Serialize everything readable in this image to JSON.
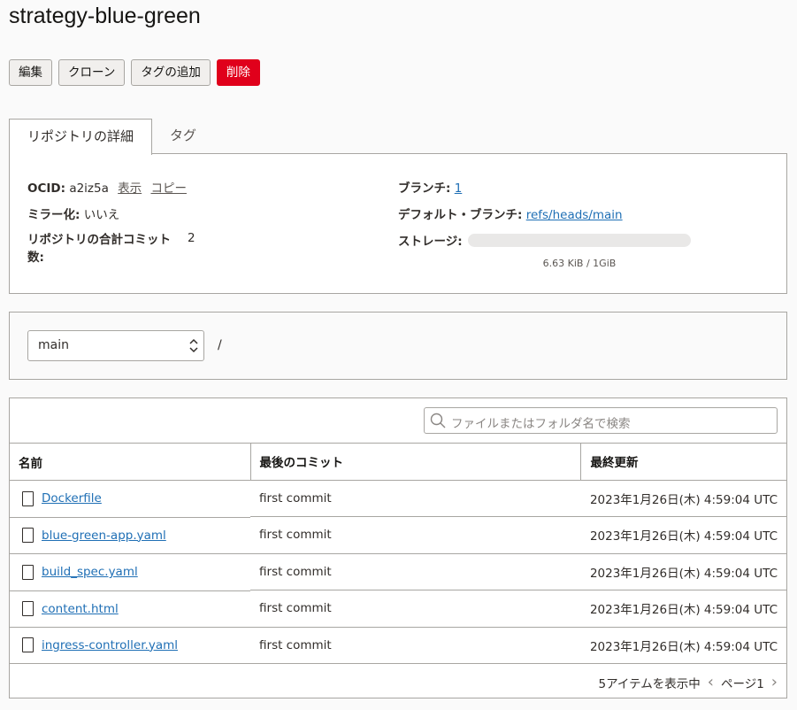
{
  "title": "strategy-blue-green",
  "actions": {
    "edit": "編集",
    "clone": "クローン",
    "add_tags": "タグの追加",
    "delete": "削除"
  },
  "tabs": {
    "details": "リポジトリの詳細",
    "tags": "タグ"
  },
  "details": {
    "ocid_label": "OCID:",
    "ocid_value": "a2iz5a",
    "show": "表示",
    "copy": "コピー",
    "mirror_label": "ミラー化:",
    "mirror_value": "いいえ",
    "commits_label": "リポジトリの合計コミット数:",
    "commits_value": "2",
    "branch_label": "ブランチ:",
    "branch_value": "1",
    "default_branch_label": "デフォルト・ブランチ:",
    "default_branch_value": "refs/heads/main",
    "storage_label": "ストレージ:",
    "storage_text": "6.63 KiB / 1GiB",
    "storage_fraction": 6.2e-06
  },
  "branch_select": {
    "value": "main",
    "path": "/"
  },
  "search": {
    "placeholder": "ファイルまたはフォルダ名で検索"
  },
  "table": {
    "headers": [
      "名前",
      "最後のコミット",
      "最終更新"
    ],
    "rows": [
      {
        "name": "Dockerfile",
        "commit": "first commit",
        "updated": "2023年1月26日(木) 4:59:04 UTC"
      },
      {
        "name": "blue-green-app.yaml",
        "commit": "first commit",
        "updated": "2023年1月26日(木) 4:59:04 UTC"
      },
      {
        "name": "build_spec.yaml",
        "commit": "first commit",
        "updated": "2023年1月26日(木) 4:59:04 UTC"
      },
      {
        "name": "content.html",
        "commit": "first commit",
        "updated": "2023年1月26日(木) 4:59:04 UTC"
      },
      {
        "name": "ingress-controller.yaml",
        "commit": "first commit",
        "updated": "2023年1月26日(木) 4:59:04 UTC"
      }
    ]
  },
  "pager": {
    "count": "5アイテムを表示中",
    "page": "ページ1"
  },
  "colors": {
    "danger": "#e0001b",
    "link": "#1f6fb5"
  }
}
